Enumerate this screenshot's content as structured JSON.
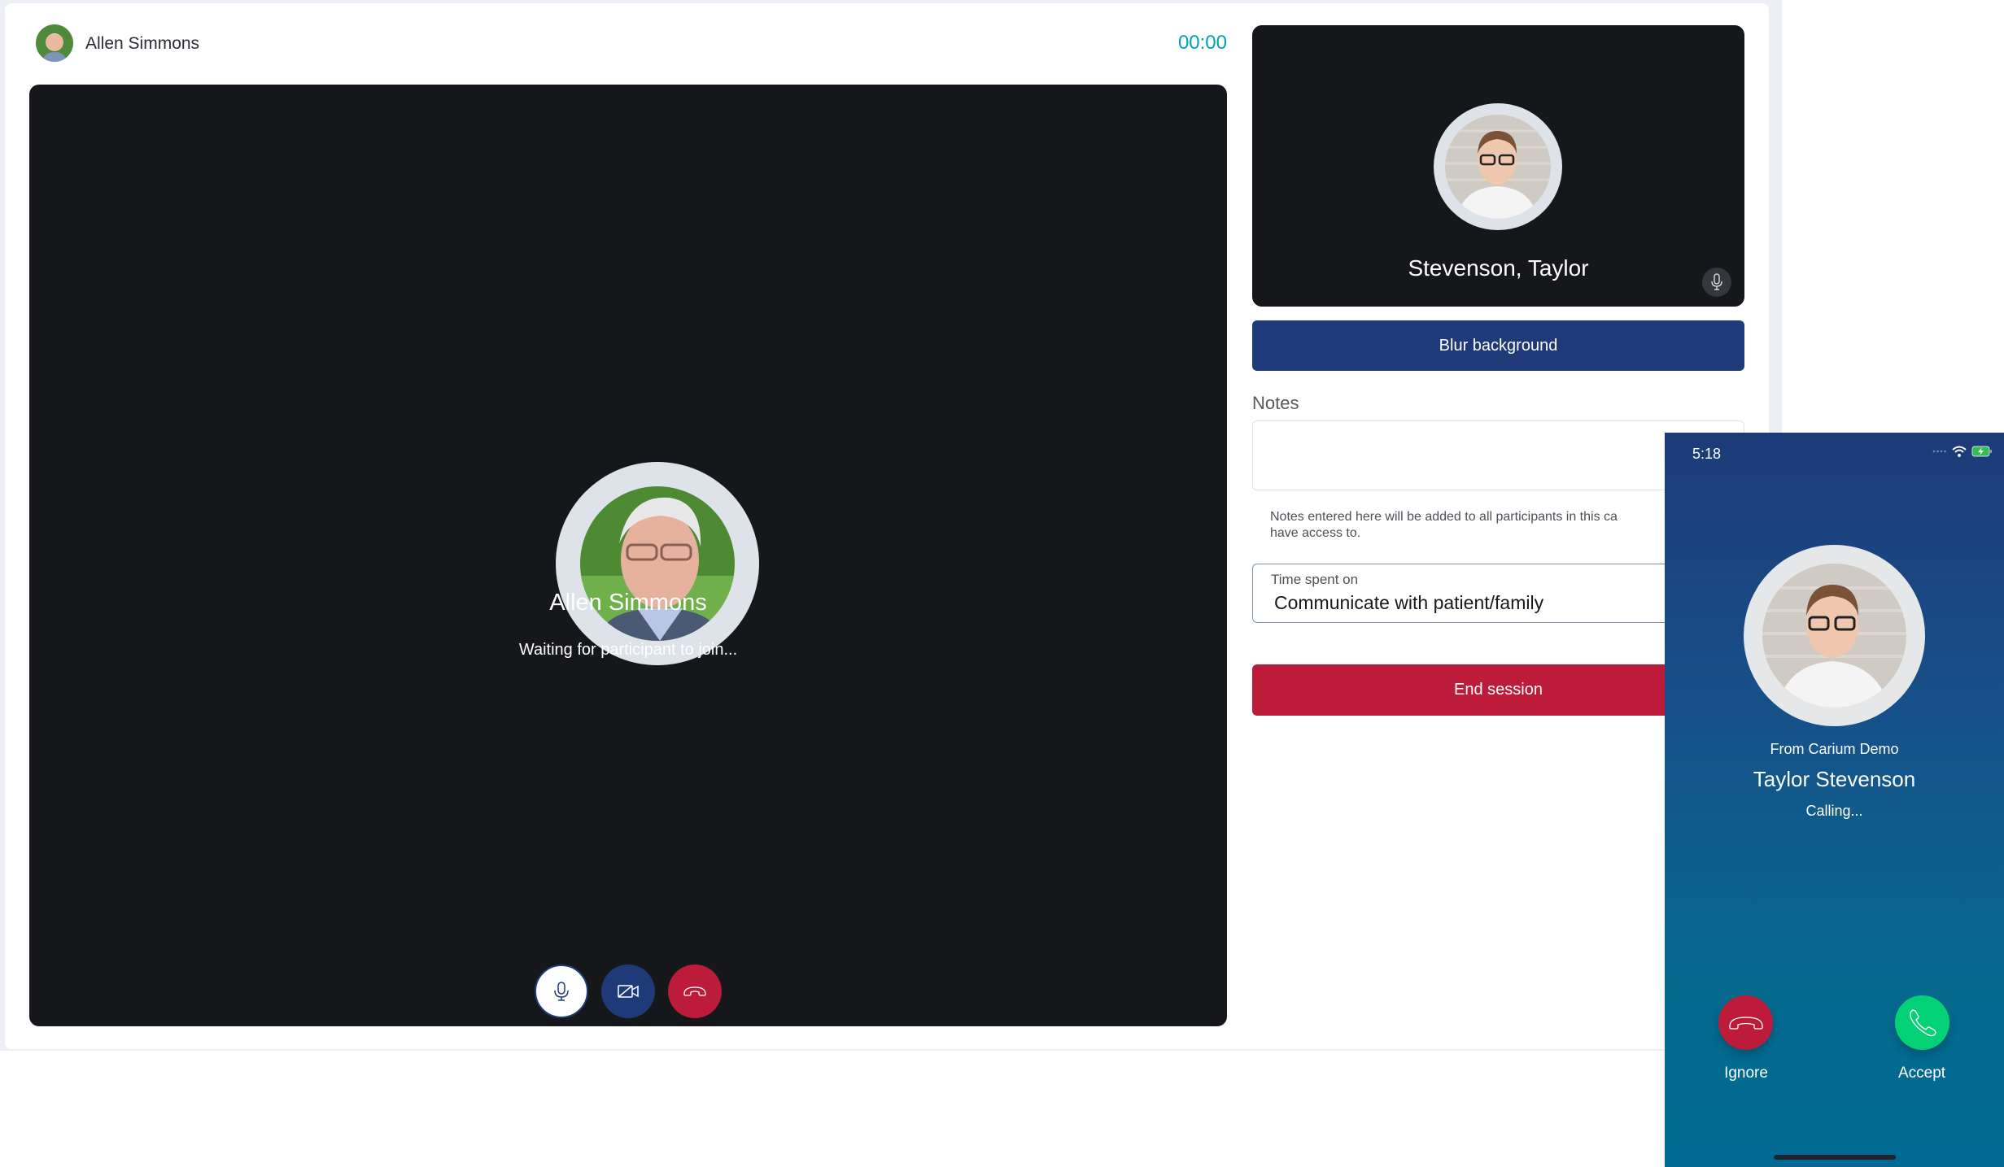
{
  "header": {
    "patient_name": "Allen Simmons",
    "timer": "00:00"
  },
  "main_video": {
    "participant_name": "Allen Simmons",
    "status": "Waiting for participant to join...",
    "controls": [
      {
        "name": "mute-microphone",
        "icon": "microphone-icon"
      },
      {
        "name": "toggle-camera",
        "icon": "camera-off-icon"
      },
      {
        "name": "hang-up",
        "icon": "phone-hangup-icon"
      }
    ]
  },
  "self_view": {
    "name": "Stevenson, Taylor",
    "mic_icon": "microphone-icon"
  },
  "side_panel": {
    "blur_button": "Blur background",
    "notes_label": "Notes",
    "notes_value": "",
    "notes_help": "Notes entered here will be added to all participants in this ca have access to.",
    "notes_help_line1": "Notes entered here will be added to all participants in this ca",
    "notes_help_line2": "have access to.",
    "time_spent_label": "Time spent on",
    "time_spent_value": "Communicate with patient/family",
    "end_session_button": "End session"
  },
  "phone": {
    "status_time": "5:18",
    "status_icons": [
      "signal-dots-icon",
      "wifi-icon",
      "battery-charging-icon"
    ],
    "from": "From Carium Demo",
    "caller": "Taylor Stevenson",
    "state": "Calling...",
    "ignore_label": "Ignore",
    "accept_label": "Accept"
  },
  "colors": {
    "accent_teal": "#00a3b4",
    "brand_navy": "#1e3a78",
    "danger_red": "#bc1c3a",
    "accept_green": "#02d176",
    "video_bg": "#16171a"
  }
}
